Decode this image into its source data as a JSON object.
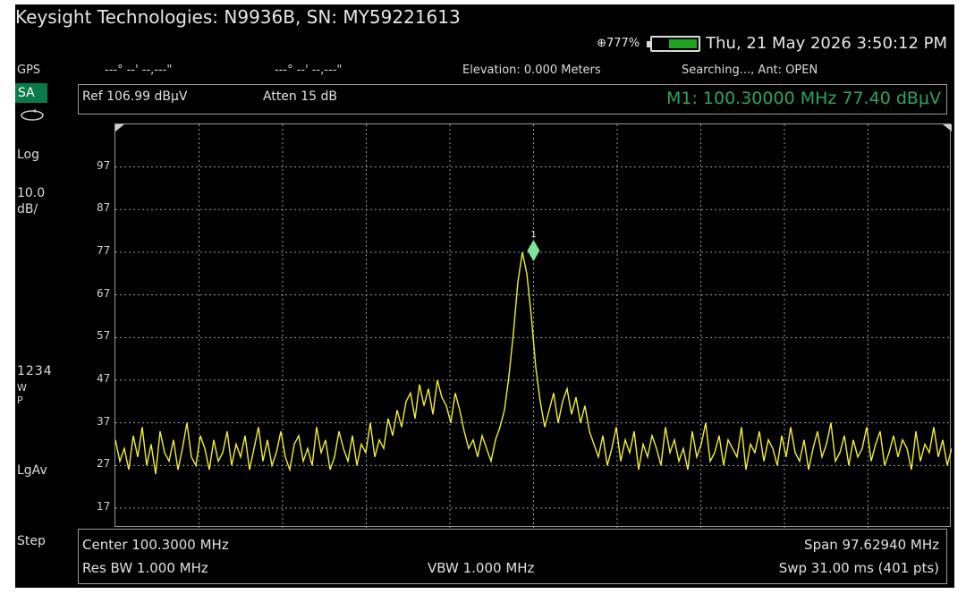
{
  "header": {
    "title": "Keysight Technologies: N9936B, SN: MY59221613",
    "signal": "⊕777%",
    "datetime": "Thu, 21 May 2026 3:50:12 PM",
    "battery_level": 0.65
  },
  "gps_row": {
    "label": "GPS",
    "lat": "---° --' --,---\"",
    "lon": "---° --' --,---\"",
    "elevation": "Elevation: 0.000 Meters",
    "status": "Searching..., Ant: OPEN"
  },
  "left_panel": {
    "mode": "SA",
    "scale_type": "Log",
    "scale_value": "10.0",
    "scale_unit": "dB/",
    "traces": "1234",
    "trace_w": "W",
    "trace_p": "P",
    "avg_type": "LgAv",
    "step": "Step"
  },
  "top_info": {
    "ref": "Ref 106.99 dBμV",
    "atten": "Atten 15 dB",
    "marker": "M1:  100.30000 MHz   77.40 dBμV"
  },
  "bottom_info": {
    "center": "Center 100.3000 MHz",
    "span": "Span 97.62940 MHz",
    "rbw": "Res BW 1.000 MHz",
    "vbw": "VBW 1.000 MHz",
    "sweep": "Swp 31.00 ms (401 pts)"
  },
  "colors": {
    "trace": "#f2ee37",
    "marker": "#7fe39a",
    "marker_text": "#2fa45f",
    "grid": "#9a9a9a",
    "mode_badge": "#0a7a4a"
  },
  "chart_data": {
    "type": "line",
    "xlabel": "",
    "ylabel": "",
    "x_center_mhz": 100.3,
    "x_span_mhz": 97.6294,
    "points": 401,
    "ylim": [
      12.39,
      106.99
    ],
    "y_ticks": [
      "97",
      "87",
      "77",
      "67",
      "57",
      "47",
      "37",
      "27",
      "17"
    ],
    "grid": true,
    "marker": {
      "label": "1",
      "x_mhz": 100.3,
      "y": 77.4
    },
    "series": [
      {
        "values": [
          33,
          28,
          31,
          26,
          34,
          29,
          36,
          27,
          32,
          25,
          35,
          30,
          28,
          33,
          26,
          31,
          37,
          29,
          27,
          34,
          31,
          26,
          33,
          28,
          30,
          35,
          27,
          32,
          29,
          34,
          26,
          31,
          36,
          28,
          33,
          27,
          30,
          35,
          29,
          26,
          32,
          34,
          28,
          31,
          27,
          36,
          30,
          33,
          26,
          29,
          35,
          31,
          28,
          34,
          27,
          32,
          30,
          37,
          29,
          33,
          31,
          38,
          34,
          40,
          36,
          42,
          44,
          38,
          46,
          41,
          45,
          39,
          47,
          43,
          41,
          37,
          44,
          40,
          35,
          31,
          33,
          29,
          34,
          31,
          28,
          33,
          36,
          40,
          48,
          58,
          70,
          77,
          72,
          62,
          50,
          42,
          36,
          40,
          44,
          37,
          42,
          45,
          39,
          43,
          37,
          41,
          35,
          32,
          29,
          34,
          27,
          31,
          36,
          28,
          33,
          30,
          35,
          26,
          32,
          29,
          34,
          31,
          27,
          36,
          30,
          33,
          28,
          31,
          26,
          35,
          29,
          32,
          37,
          28,
          30,
          34,
          27,
          33,
          31,
          29,
          36,
          26,
          32,
          30,
          35,
          28,
          33,
          31,
          27,
          34,
          29,
          36,
          30,
          28,
          33,
          26,
          31,
          35,
          29,
          32,
          37,
          28,
          30,
          34,
          27,
          33,
          29,
          31,
          36,
          28,
          32,
          35,
          27,
          30,
          34,
          29,
          33,
          31,
          26,
          35,
          28,
          32,
          30,
          36,
          29,
          33,
          27,
          31
        ]
      }
    ]
  }
}
